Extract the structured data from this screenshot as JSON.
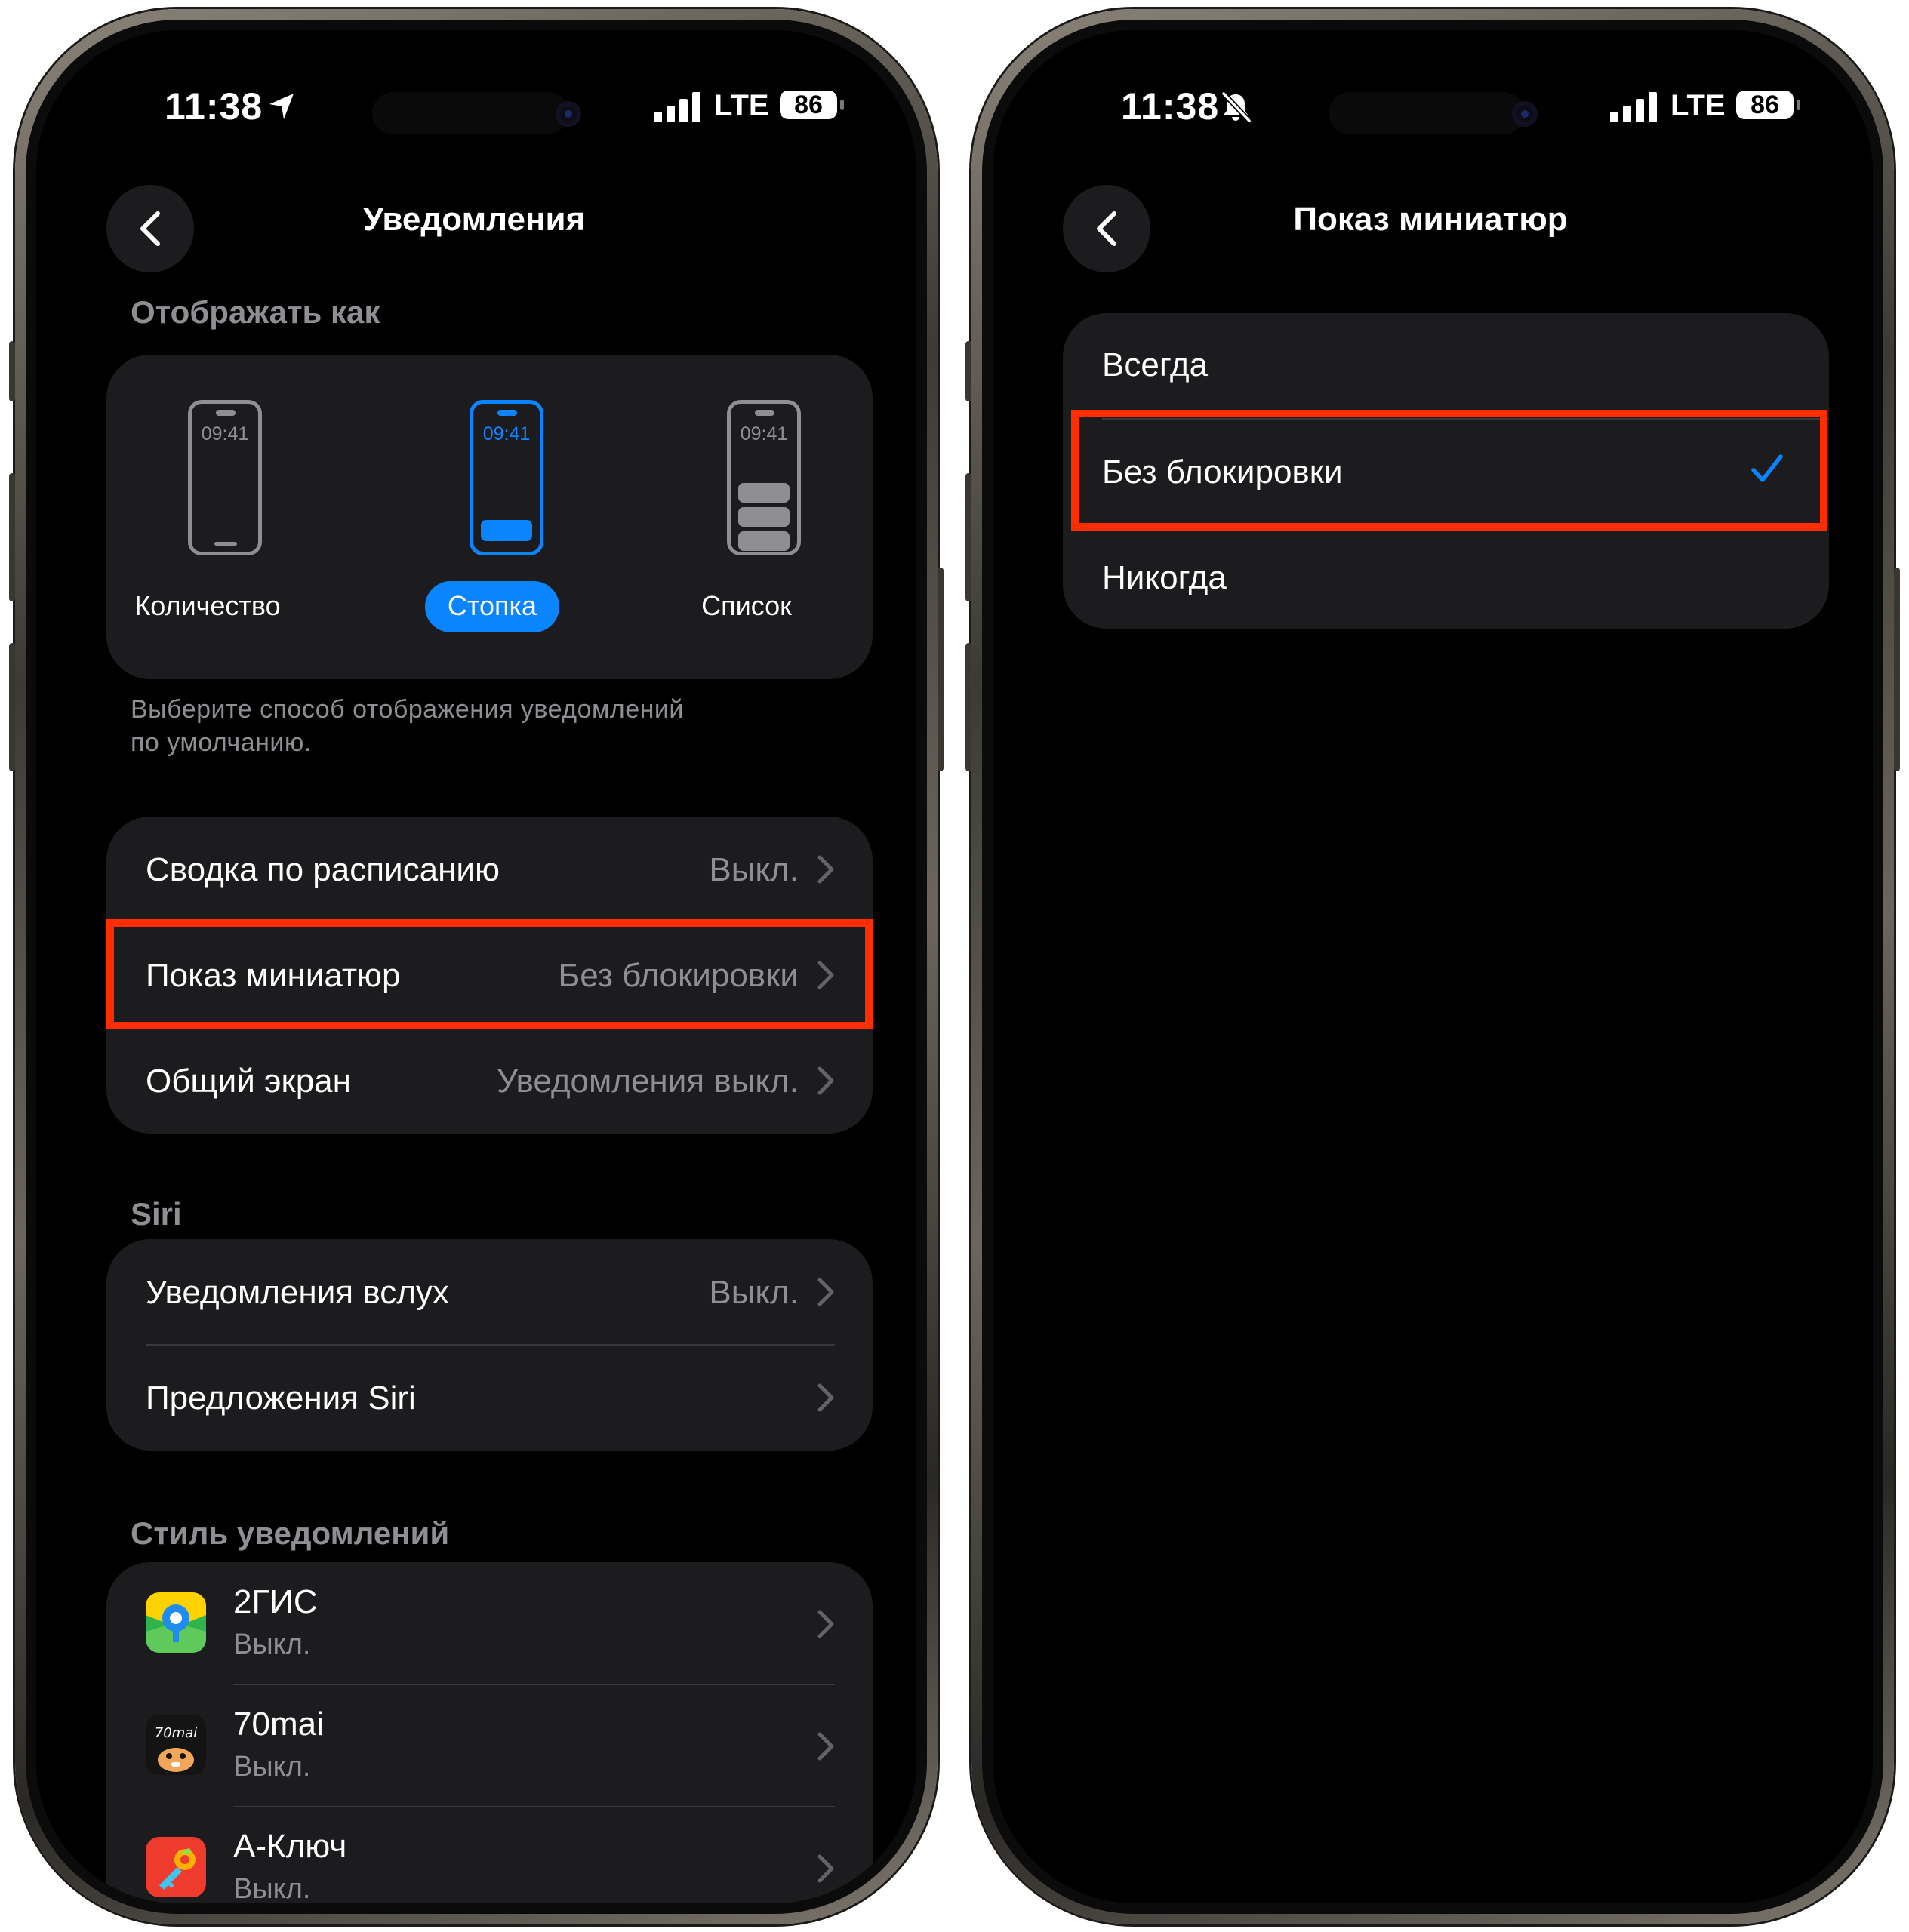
{
  "left": {
    "status": {
      "time": "11:38",
      "network": "LTE",
      "battery": "86"
    },
    "nav": {
      "title": "Уведомления"
    },
    "display_as": {
      "header": "Отображать как",
      "options": [
        {
          "label": "Количество",
          "preview_time": "09:41"
        },
        {
          "label": "Стопка",
          "preview_time": "09:41",
          "selected": true
        },
        {
          "label": "Список",
          "preview_time": "09:41"
        }
      ],
      "footer_line1": "Выберите способ отображения уведомлений",
      "footer_line2": "по умолчанию."
    },
    "settings": [
      {
        "label": "Сводка по расписанию",
        "value": "Выкл."
      },
      {
        "label": "Показ миниатюр",
        "value": "Без блокировки"
      },
      {
        "label": "Общий экран",
        "value": "Уведомления выкл."
      }
    ],
    "siri": {
      "header": "Siri",
      "rows": [
        {
          "label": "Уведомления вслух",
          "value": "Выкл."
        },
        {
          "label": "Предложения Siri",
          "value": ""
        }
      ]
    },
    "notification_style": {
      "header": "Стиль уведомлений",
      "apps": [
        {
          "name": "2ГИС",
          "status": "Выкл."
        },
        {
          "name": "70mai",
          "status": "Выкл.",
          "icon_text": "70mai"
        },
        {
          "name": "A-Ключ",
          "status": "Выкл."
        }
      ]
    }
  },
  "right": {
    "status": {
      "time": "11:38",
      "network": "LTE",
      "battery": "86"
    },
    "nav": {
      "title": "Показ миниатюр"
    },
    "options": [
      {
        "label": "Всегда"
      },
      {
        "label": "Без блокировки",
        "selected": true
      },
      {
        "label": "Никогда"
      }
    ]
  },
  "colors": {
    "accent": "#0a84ff",
    "highlight": "#ff2d00",
    "group_bg": "#1c1c1e",
    "secondary_text": "#8e8e93"
  }
}
